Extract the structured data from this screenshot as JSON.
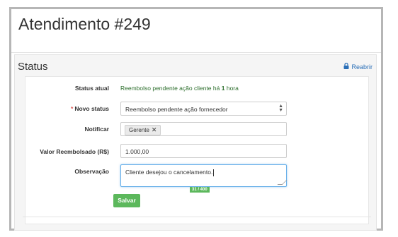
{
  "page": {
    "title": "Atendimento #249"
  },
  "status_panel": {
    "title": "Status",
    "reopen_label": "Reabrir",
    "current_status": {
      "label": "Status atual",
      "value_prefix": "Reembolso pendente ação cliente há",
      "value_count": "1",
      "value_suffix": "hora"
    },
    "new_status": {
      "required_mark": "*",
      "label": "Novo status",
      "selected": "Reembolso pendente ação fornecedor"
    },
    "notify": {
      "label": "Notificar",
      "tags": [
        "Gerente"
      ]
    },
    "refund_value": {
      "label": "Valor Reembolsado (R$)",
      "value": "1.000,00"
    },
    "observation": {
      "label": "Observação",
      "value": "Cliente desejou o cancelamento.",
      "counter": "31 / 400"
    },
    "save_label": "Salvar"
  },
  "colors": {
    "accent_green": "#5cb85c",
    "link_blue": "#2a6fb8",
    "status_text": "#2c6e2c",
    "required_red": "#d9534f"
  }
}
